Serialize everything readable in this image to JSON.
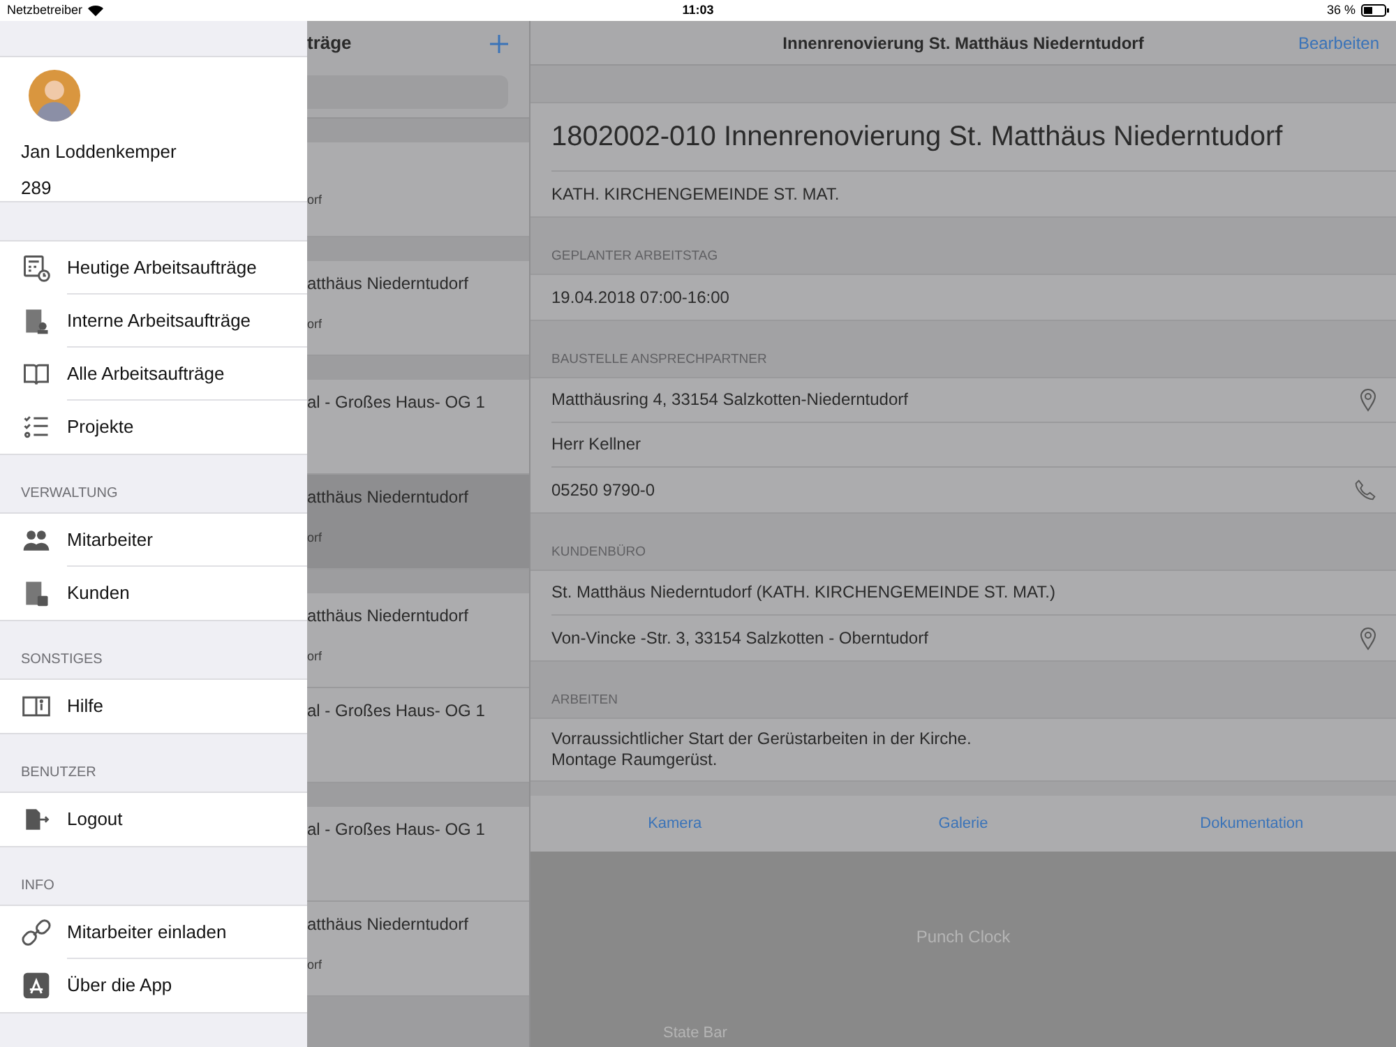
{
  "status_bar": {
    "carrier": "Netzbetreiber",
    "time": "11:03",
    "battery": "36 %"
  },
  "drawer": {
    "user": {
      "name": "Jan Loddenkemper",
      "number": "289"
    },
    "sections": [
      {
        "items": [
          {
            "label": "Heutige Arbeitsaufträge"
          },
          {
            "label": "Interne Arbeitsaufträge"
          },
          {
            "label": "Alle Arbeitsaufträge"
          },
          {
            "label": "Projekte"
          }
        ]
      },
      {
        "header": "VERWALTUNG",
        "items": [
          {
            "label": "Mitarbeiter"
          },
          {
            "label": "Kunden"
          }
        ]
      },
      {
        "header": "SONSTIGES",
        "items": [
          {
            "label": "Hilfe"
          }
        ]
      },
      {
        "header": "BENUTZER",
        "items": [
          {
            "label": "Logout"
          }
        ]
      },
      {
        "header": "INFO",
        "items": [
          {
            "label": "Mitarbeiter einladen"
          },
          {
            "label": "Über die App"
          }
        ]
      }
    ]
  },
  "list": {
    "title": "träge",
    "sections": [
      [
        {
          "subtitle": "orf",
          "selected": false
        }
      ],
      [
        {
          "title": "atthäus Niederntudorf",
          "subtitle": "orf",
          "selected": false
        }
      ],
      [
        {
          "title": "al - Großes Haus- OG 1",
          "selected": false
        },
        {
          "title": "atthäus Niederntudorf",
          "subtitle": "orf",
          "selected": true
        }
      ],
      [
        {
          "title": "atthäus Niederntudorf",
          "subtitle": "orf",
          "selected": false
        },
        {
          "title": "al - Großes Haus- OG 1",
          "selected": false
        }
      ],
      [
        {
          "title": "al - Großes Haus- OG 1",
          "selected": false
        },
        {
          "title": "atthäus Niederntudorf",
          "subtitle": "orf",
          "selected": false
        }
      ]
    ]
  },
  "detail": {
    "nav_title": "Innenrenovierung St. Matthäus Niederntudorf",
    "edit_button": "Bearbeiten",
    "title": "1802002-010 Innenrenovierung St. Matthäus Niederntudorf",
    "subtitle": "KATH. KIRCHENGEMEINDE ST. MAT.",
    "sections": [
      {
        "header": "GEPLANTER ARBEITSTAG",
        "rows": [
          {
            "kind": "text",
            "text": "19.04.2018 07:00-16:00"
          }
        ]
      },
      {
        "header": "BAUSTELLE ANSPRECHPARTNER",
        "rows": [
          {
            "kind": "address",
            "text": "Matthäusring 4, 33154 Salzkotten-Niederntudorf"
          },
          {
            "kind": "text",
            "text": "Herr Kellner"
          },
          {
            "kind": "phone",
            "text": "05250 9790-0"
          }
        ]
      },
      {
        "header": "KUNDENBÜRO",
        "rows": [
          {
            "kind": "text",
            "text": "St. Matthäus Niederntudorf (KATH. KIRCHENGEMEINDE ST. MAT.)"
          },
          {
            "kind": "address",
            "text": "Von-Vincke -Str. 3, 33154 Salzkotten - Oberntudorf"
          }
        ]
      },
      {
        "header": "ARBEITEN",
        "rows": [
          {
            "kind": "multiline",
            "text": "Vorraussichtlicher Start der Gerüstarbeiten in der Kirche.\nMontage Raumgerüst."
          }
        ]
      }
    ],
    "actions": [
      "Kamera",
      "Galerie",
      "Dokumentation"
    ],
    "punch_clock": "Punch Clock",
    "state_bar": "State Bar"
  }
}
